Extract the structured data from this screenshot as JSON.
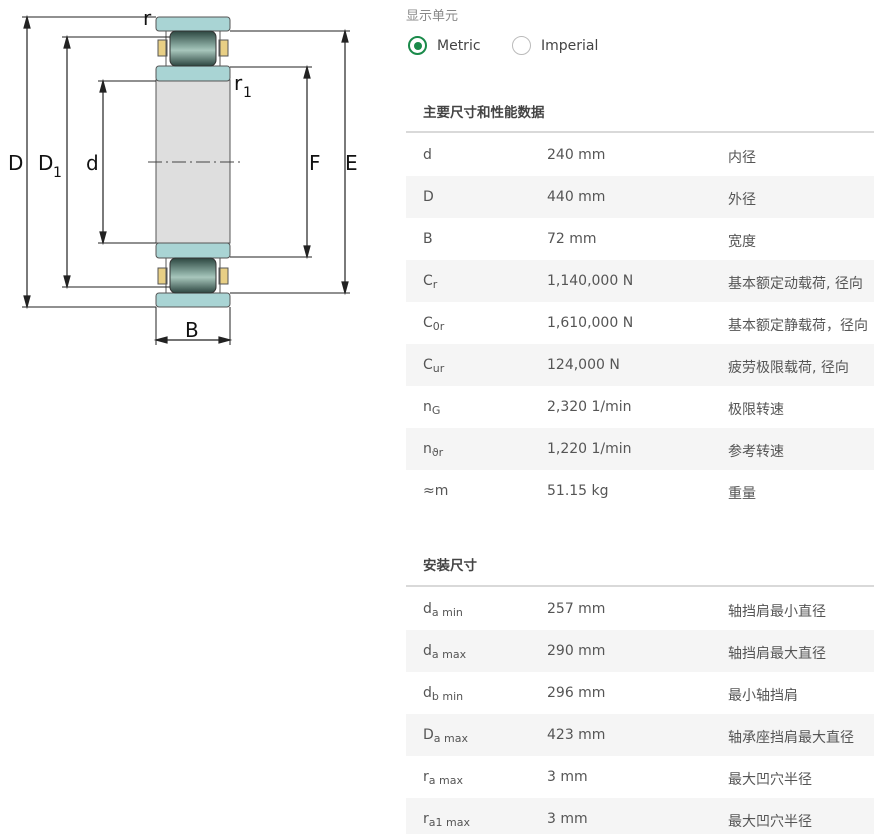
{
  "diagram": {
    "labels": {
      "D": "D",
      "D1_main": "D",
      "D1_sub": "1",
      "d": "d",
      "F": "F",
      "E": "E",
      "B": "B",
      "r": "r",
      "r1_main": "r",
      "r1_sub": "1"
    }
  },
  "units": {
    "title": "显示单元",
    "metric_label": "Metric",
    "imperial_label": "Imperial",
    "selected": "Metric"
  },
  "main_section": {
    "title": "主要尺寸和性能数据",
    "rows": [
      {
        "symbol": "d",
        "sub": "",
        "value": "240 mm",
        "desc": "内径"
      },
      {
        "symbol": "D",
        "sub": "",
        "value": "440 mm",
        "desc": "外径"
      },
      {
        "symbol": "B",
        "sub": "",
        "value": "72 mm",
        "desc": "宽度"
      },
      {
        "symbol": "C",
        "sub": "r",
        "value": "1,140,000 N",
        "desc": "基本额定动载荷, 径向"
      },
      {
        "symbol": "C",
        "sub": "0r",
        "value": "1,610,000 N",
        "desc": "基本额定静载荷，径向"
      },
      {
        "symbol": "C",
        "sub": "ur",
        "value": "124,000 N",
        "desc": "疲劳极限载荷, 径向"
      },
      {
        "symbol": "n",
        "sub": "G",
        "value": "2,320 1/min",
        "desc": "极限转速"
      },
      {
        "symbol": "n",
        "sub": "ϑr",
        "value": "1,220 1/min",
        "desc": "参考转速"
      },
      {
        "symbol": "≈m",
        "sub": "",
        "value": "51.15 kg",
        "desc": "重量"
      }
    ]
  },
  "mounting_section": {
    "title": "安装尺寸",
    "rows": [
      {
        "symbol": "d",
        "sub": "a min",
        "value": "257 mm",
        "desc": "轴挡肩最小直径"
      },
      {
        "symbol": "d",
        "sub": "a max",
        "value": "290 mm",
        "desc": "轴挡肩最大直径"
      },
      {
        "symbol": "d",
        "sub": "b min",
        "value": "296 mm",
        "desc": "最小轴挡肩"
      },
      {
        "symbol": "D",
        "sub": "a max",
        "value": "423 mm",
        "desc": "轴承座挡肩最大直径"
      },
      {
        "symbol": "r",
        "sub": "a max",
        "value": "3 mm",
        "desc": "最大凹穴半径"
      },
      {
        "symbol": "r",
        "sub": "a1 max",
        "value": "3 mm",
        "desc": "最大凹穴半径"
      }
    ]
  },
  "colors": {
    "accent_green": "#1a8a4a",
    "ring_teal": "#a9d4d4",
    "bore_grey": "#dedede",
    "cage_yellow": "#e8cf85",
    "roller_dark": "#3e5a52"
  }
}
